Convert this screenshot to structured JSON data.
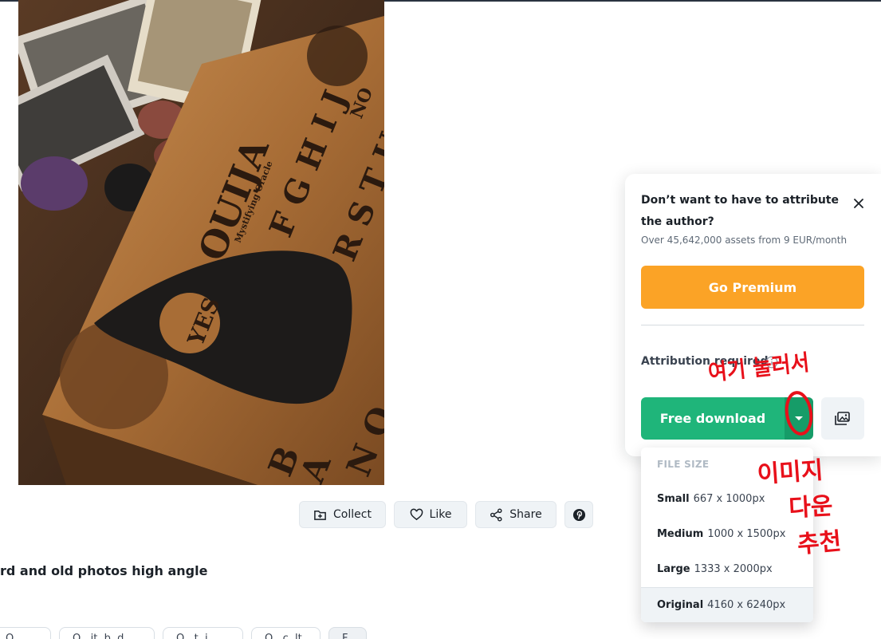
{
  "photo": {
    "description_icon": "photo",
    "board_words": [
      "OUIJA",
      "NO",
      "YES"
    ],
    "board_text_small": "Mystifying Oracle"
  },
  "actions": {
    "collect_label": "Collect",
    "like_label": "Like",
    "share_label": "Share"
  },
  "resource": {
    "title_fragment": "rd and old photos high angle",
    "tags": [
      "Q ..",
      "Q ..it..b..d",
      "Q ..t..i..",
      "Q ..c..lt",
      "F.."
    ]
  },
  "panel": {
    "promo_title": "Don’t want to have to attribute the author?",
    "promo_subtitle": "Over 45,642,000 assets from 9 EUR/month",
    "premium_label": "Go Premium",
    "attribution_label": "Attribution required",
    "free_download_label": "Free download"
  },
  "dropdown": {
    "header": "FILE SIZE",
    "options": [
      {
        "name": "Small",
        "dims": "667 x 1000px"
      },
      {
        "name": "Medium",
        "dims": "1000 x 1500px"
      },
      {
        "name": "Large",
        "dims": "1333 x 2000px"
      },
      {
        "name": "Original",
        "dims": "4160 x 6240px"
      }
    ]
  },
  "annotations": {
    "note_1": "여기 눌러서",
    "note_2_line1": "이미지",
    "note_2_line2": "다운",
    "note_2_line3": "추천"
  },
  "colors": {
    "premium": "#fba326",
    "download_green": "#1fb57a",
    "annotation_red": "#e8101a"
  }
}
